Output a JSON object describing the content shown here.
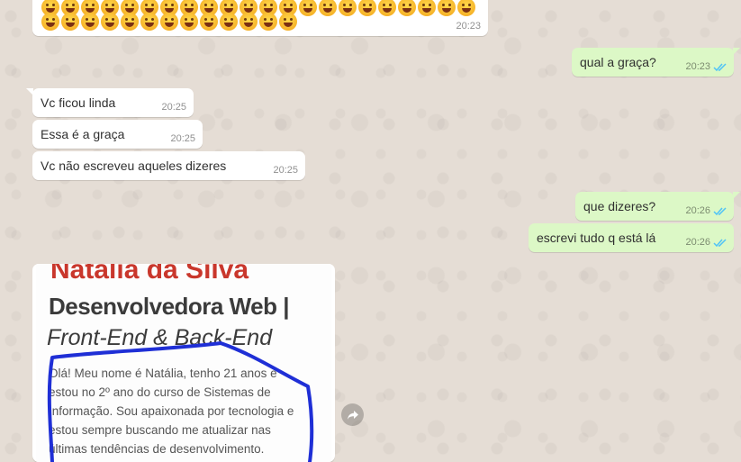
{
  "messages": [
    {
      "id": "m0",
      "direction": "in",
      "content": "emoji",
      "emoji_name": "laughing-face-emoji",
      "time": "20:23"
    },
    {
      "id": "m1",
      "direction": "out",
      "text": "qual a graça?",
      "time": "20:23",
      "status": "read"
    },
    {
      "id": "m2",
      "direction": "in",
      "text": "Vc ficou linda",
      "time": "20:25"
    },
    {
      "id": "m3",
      "direction": "in",
      "text": "Essa é a graça",
      "time": "20:25"
    },
    {
      "id": "m4",
      "direction": "in",
      "text": "Vc não escreveu aqueles dizeres",
      "time": "20:25"
    },
    {
      "id": "m5",
      "direction": "out",
      "text": "que dizeres?",
      "time": "20:26",
      "status": "read"
    },
    {
      "id": "m6",
      "direction": "out",
      "text": "escrevi tudo q está lá",
      "time": "20:26",
      "status": "read"
    }
  ],
  "image_message": {
    "name": "Natália da Silva",
    "role": "Desenvolvedora Web |",
    "subtitle": "Front-End & Back-End",
    "body_lines": [
      "Olá! Meu nome é Natália, tenho 21 anos e",
      "estou no 2º ano do curso de Sistemas de",
      "Informação. Sou apaixonada por tecnologia e",
      "estou sempre buscando me atualizar nas",
      "últimas tendências de desenvolvimento."
    ],
    "annotation_color": "#1f2fd6"
  },
  "icons": {
    "forward": "forward-icon",
    "read_ticks": "double-check-icon"
  },
  "colors": {
    "wallpaper": "#e5ddd5",
    "incoming": "#ffffff",
    "outgoing": "#dcf8c6",
    "read_tick": "#4fc3f7",
    "name_red": "#c9372c"
  }
}
